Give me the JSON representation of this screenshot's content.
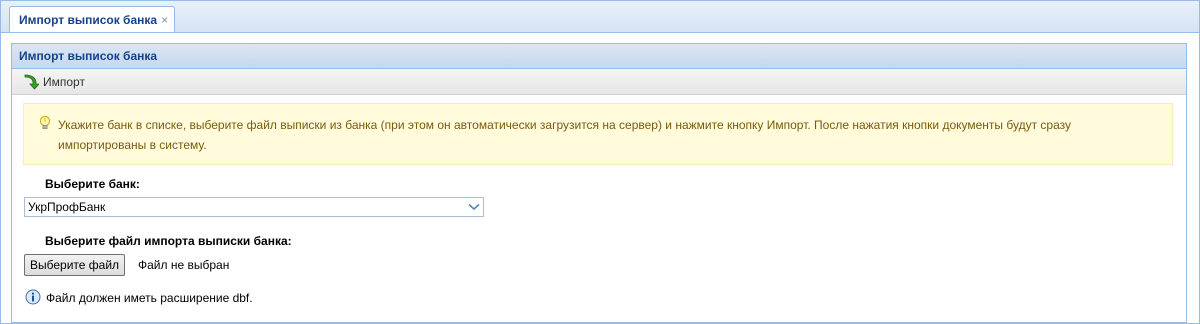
{
  "tabs": [
    {
      "label": "Импорт выписок банка",
      "active": true
    }
  ],
  "icons": {
    "tab_close": "close-icon",
    "import": "green-arrow-import-icon",
    "hint": "lightbulb-icon",
    "dropdown": "chevron-down-icon",
    "info": "info-icon"
  },
  "panel": {
    "title": "Импорт выписок банка"
  },
  "toolbar": {
    "import_label": "Импорт"
  },
  "hint": {
    "text": "Укажите банк в списке, выберите файл выписки из банка (при этом он автоматически загрузится на сервер) и нажмите кнопку Импорт. После нажатия кнопки документы будут сразу импортированы в систему."
  },
  "form": {
    "bank_label": "Выберите банк:",
    "bank_value": "УкрПрофБанк",
    "file_label": "Выберите файл импорта выписки банка:",
    "file_button": "Выберите файл",
    "file_status": "Файл не выбран",
    "file_note": "Файл должен иметь расширение dbf."
  },
  "colors": {
    "accent": "#15428b",
    "border": "#99bbe8",
    "hint_bg": "#fffbdb",
    "hint_text": "#7a5b0d"
  }
}
